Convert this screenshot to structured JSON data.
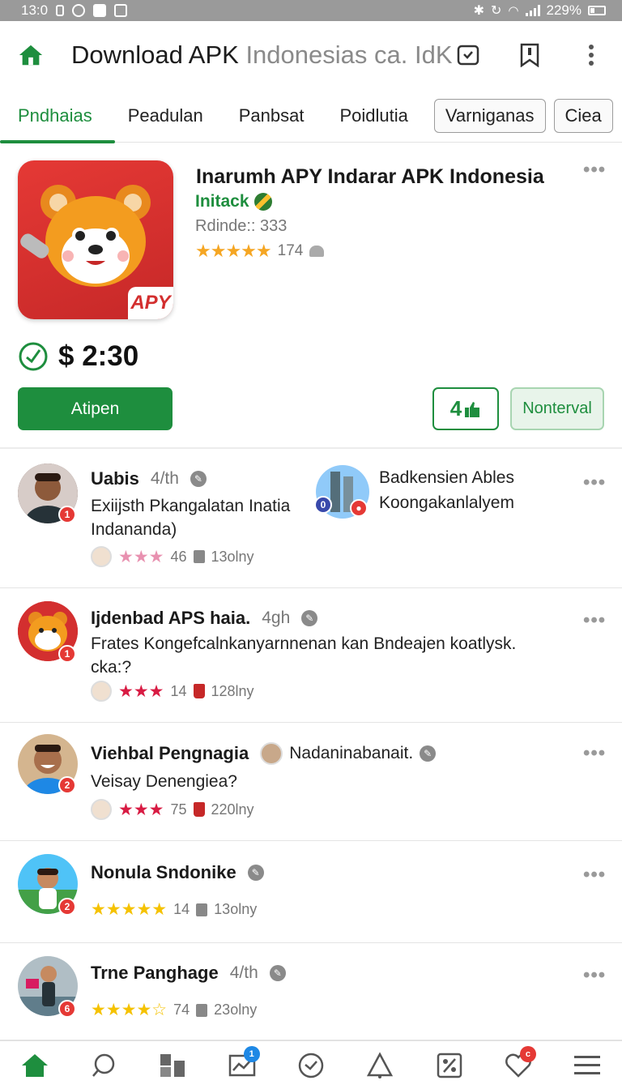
{
  "status_bar": {
    "time": "13:0",
    "battery": "229%"
  },
  "app_bar": {
    "title_main": "Download APK",
    "title_muted": "Indonesias ca. IdK"
  },
  "tabs": [
    {
      "label": "Pndhaias",
      "active": true
    },
    {
      "label": "Peadulan"
    },
    {
      "label": "Panbsat"
    },
    {
      "label": "Poidlutia"
    }
  ],
  "chips": [
    {
      "label": "Varniganas"
    },
    {
      "label": "Ciea"
    }
  ],
  "app": {
    "title": "Inarumh APY Indarar APK Indonesia",
    "developer": "Initack",
    "meta": "Rdinde:: 333",
    "stars": "★★★★★",
    "rating_count": "174",
    "icon_label": "APY",
    "price": "$ 2:30",
    "install_label": "Atipen",
    "like_count": "4",
    "secondary_label": "Nonterval",
    "accent_color": "#1e8e3e"
  },
  "reviews": [
    {
      "name": "Uabis",
      "ago": "4/th",
      "text": "Exiijsth Pkangalatan Inatia Indananda)",
      "stars": "★★★",
      "count": "46",
      "time": "13olny",
      "badge": "1",
      "side_badge": "0",
      "side_text": [
        "Badkensien Ables",
        "Koongakanlalyem"
      ]
    },
    {
      "name": "Ijdenbad APS haia.",
      "ago": "4gh",
      "text": "Frates Kongefcalnkanyarnnenan kan Bndeajen koatlysk. cka:?",
      "stars": "★★★",
      "count": "14",
      "time": "128lny",
      "badge": "1"
    },
    {
      "name": "Viehbal Pengnagia",
      "name_extra": "Nadaninabanait.",
      "text": "Veisay Denengiea?",
      "stars": "★★★",
      "count": "75",
      "time": "220lny",
      "badge": "2"
    },
    {
      "name": "Nonula Sndonike",
      "stars": "★★★★★",
      "count": "14",
      "time": "13olny",
      "badge": "2"
    },
    {
      "name": "Trne Panghage",
      "ago": "4/th",
      "stars": "★★★★☆",
      "count": "74",
      "time": "23olny",
      "badge": "6"
    }
  ],
  "bottom_nav": [
    {
      "icon": "home-icon"
    },
    {
      "icon": "search-icon"
    },
    {
      "icon": "apps-icon"
    },
    {
      "icon": "chart-icon",
      "badge": "1"
    },
    {
      "icon": "check-circle-icon"
    },
    {
      "icon": "bell-icon"
    },
    {
      "icon": "percent-icon"
    },
    {
      "icon": "heart-icon",
      "badge": "c"
    },
    {
      "icon": "menu-icon"
    }
  ]
}
